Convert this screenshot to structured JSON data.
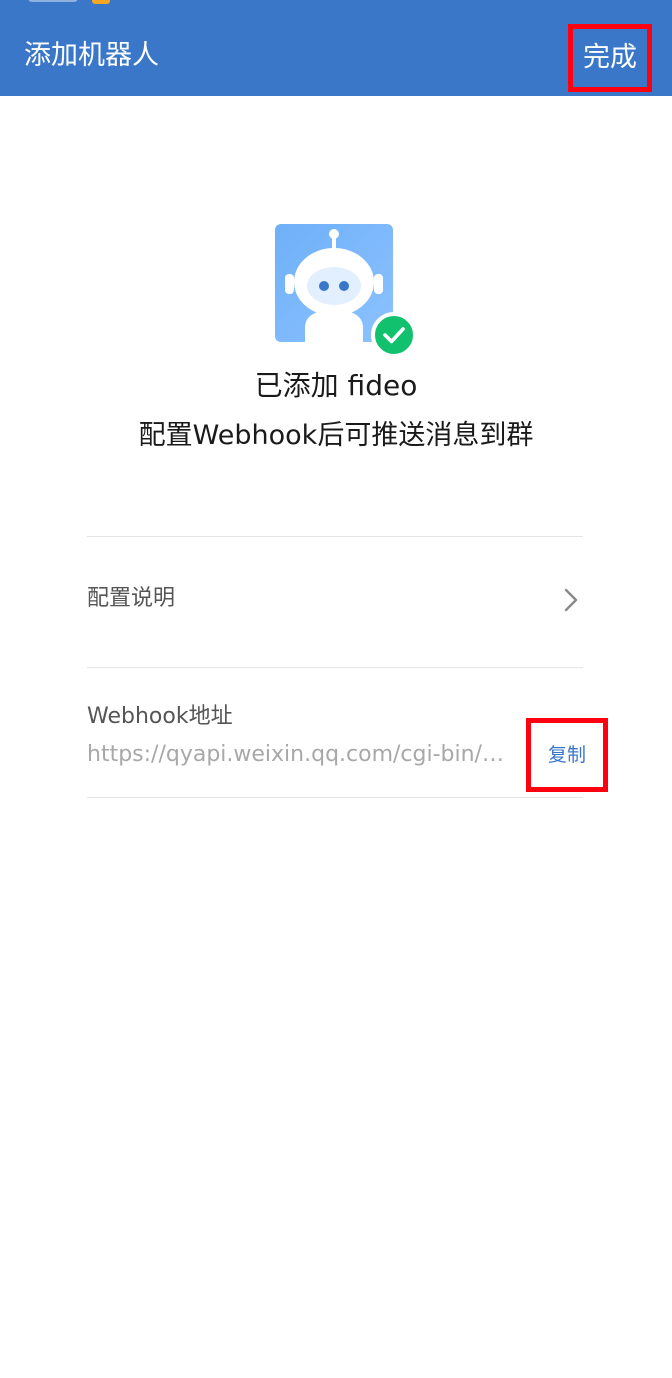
{
  "header": {
    "title": "添加机器人",
    "done_label": "完成",
    "background_color": "#3a77c9"
  },
  "bot": {
    "added_text": "已添加 fideo",
    "description": "配置Webhook后可推送消息到群",
    "avatar_icon": "robot-icon",
    "status_icon": "check-icon",
    "status_color": "#12c16e"
  },
  "config": {
    "label": "配置说明",
    "icon": "chevron-right-icon"
  },
  "webhook": {
    "label": "Webhook地址",
    "url": "https://qyapi.weixin.qq.com/cgi-bin/…",
    "copy_label": "复制",
    "copy_color": "#3a77c9"
  },
  "highlight_color": "#ff0011"
}
